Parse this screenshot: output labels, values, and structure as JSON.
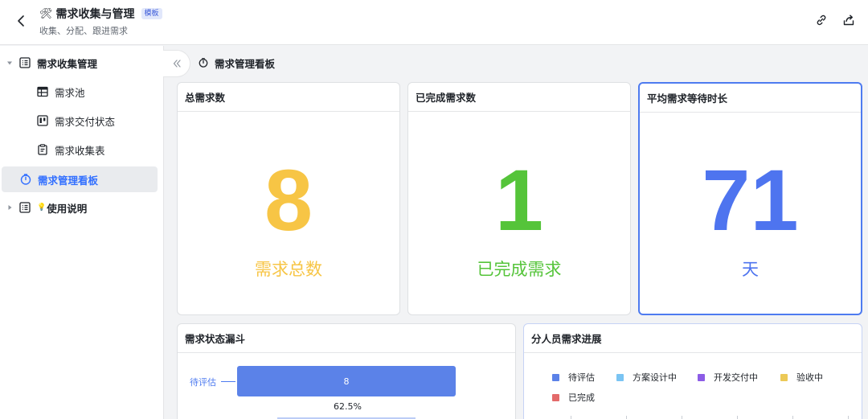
{
  "header": {
    "title_emoji": "🛠",
    "title": "需求收集与管理",
    "tag": "模板",
    "subtitle": "收集、分配、跟进需求"
  },
  "sidebar": {
    "items": [
      {
        "label": "需求收集管理",
        "icon": "list-icon",
        "level": 0,
        "expanded": true
      },
      {
        "label": "需求池",
        "icon": "table-icon",
        "level": 1
      },
      {
        "label": "需求交付状态",
        "icon": "kanban-icon",
        "level": 1
      },
      {
        "label": "需求收集表",
        "icon": "form-icon",
        "level": 1
      },
      {
        "label": "需求管理看板",
        "icon": "dashboard-icon",
        "level": 0,
        "active": true
      },
      {
        "label": "使用说明",
        "icon": "list-icon",
        "prefix_emoji": "💡",
        "level": 0,
        "expanded": false
      }
    ]
  },
  "page": {
    "title": "需求管理看板"
  },
  "metrics": [
    {
      "title": "总需求数",
      "value": "8",
      "caption": "需求总数",
      "color": "#f7c545"
    },
    {
      "title": "已完成需求数",
      "value": "1",
      "caption": "已完成需求",
      "color": "#55c43a"
    },
    {
      "title": "平均需求等待时长",
      "value": "71",
      "caption": "天",
      "color": "#4e74ef"
    }
  ],
  "funnel": {
    "title": "需求状态漏斗",
    "stages": [
      {
        "label": "待评估",
        "value": "8"
      }
    ],
    "conversion": "62.5%"
  },
  "progress": {
    "title": "分人员需求进展",
    "legend": [
      {
        "label": "待评估",
        "color": "#5b82e8"
      },
      {
        "label": "方案设计中",
        "color": "#7ac4f3"
      },
      {
        "label": "开发交付中",
        "color": "#8c5ce6"
      },
      {
        "label": "验收中",
        "color": "#ecc957"
      },
      {
        "label": "已完成",
        "color": "#e36a6a"
      }
    ]
  }
}
